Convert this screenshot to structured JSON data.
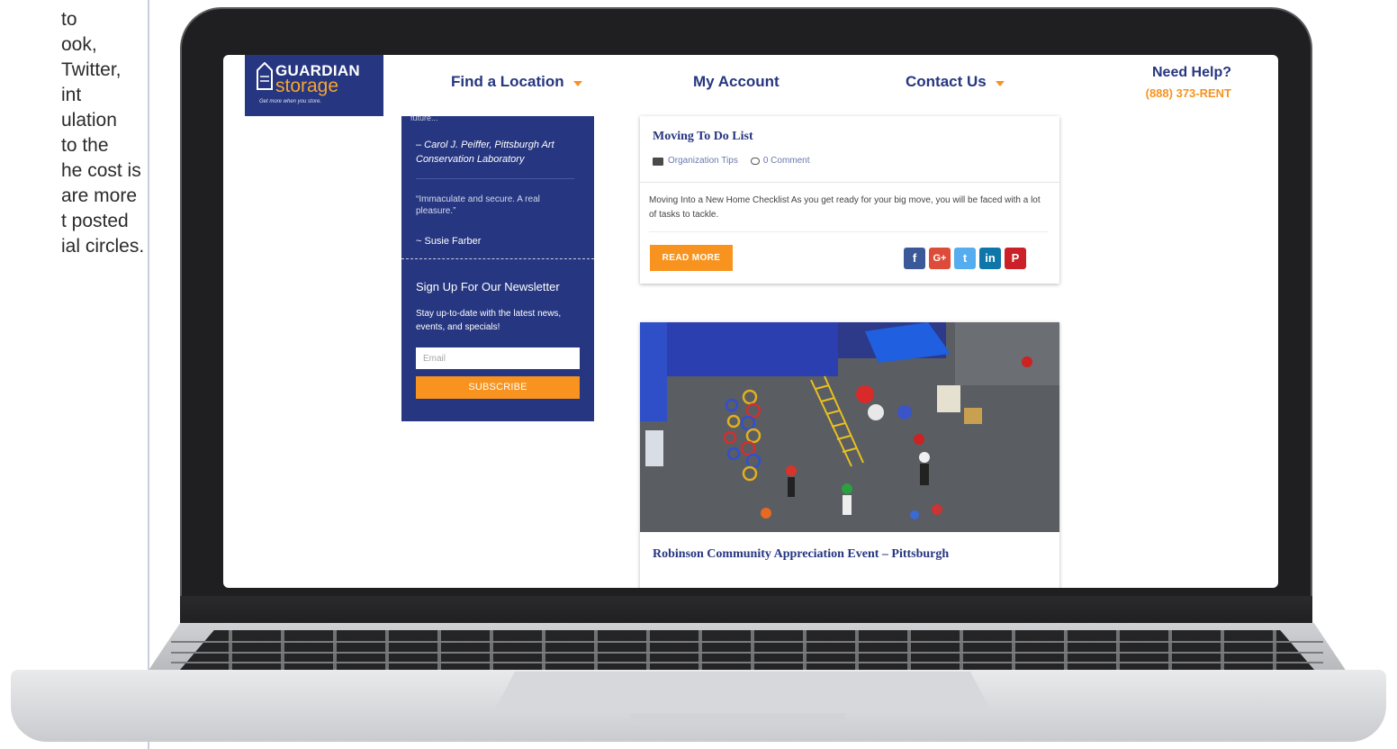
{
  "slide_text": {
    "lines": [
      "to",
      "ook,",
      "Twitter,",
      "int",
      "ulation",
      "to the",
      "he cost is",
      "are more",
      "t posted",
      "ial circles."
    ]
  },
  "header": {
    "logo": {
      "brand_top": "GUARDIAN",
      "brand_bottom": "storage",
      "tagline": "Get more when you store."
    },
    "nav": [
      {
        "label": "Find a Location",
        "has_dropdown": true
      },
      {
        "label": "My Account",
        "has_dropdown": false
      },
      {
        "label": "Contact Us",
        "has_dropdown": true
      }
    ],
    "help": {
      "title": "Need Help?",
      "phone": "(888) 373-RENT"
    }
  },
  "sidebar": {
    "cut_text": "future...",
    "testimonial_author_1": "– Carol J. Peiffer, Pittsburgh Art Conservation Laboratory",
    "testimonial_quote_2": "“Immaculate and secure. A real pleasure.”",
    "testimonial_author_2": "~ Susie Farber",
    "newsletter": {
      "title": "Sign Up For Our Newsletter",
      "text": "Stay up-to-date with the latest news, events, and specials!",
      "email_placeholder": "Email",
      "button": "SUBSCRIBE"
    }
  },
  "posts": [
    {
      "title": "Moving To Do List",
      "category": "Organization Tips",
      "comments": "0 Comment",
      "excerpt": "Moving Into a New Home Checklist As you get ready for your big move, you will be faced with a lot of tasks to tackle.",
      "read_more": "READ MORE",
      "share": [
        {
          "icon": "facebook-icon",
          "glyph": "f",
          "color": "#3b5998"
        },
        {
          "icon": "google-plus-icon",
          "glyph": "G+",
          "color": "#dd4b39"
        },
        {
          "icon": "twitter-icon",
          "glyph": "t",
          "color": "#55acee"
        },
        {
          "icon": "linkedin-icon",
          "glyph": "in",
          "color": "#0e76a8"
        },
        {
          "icon": "pinterest-icon",
          "glyph": "P",
          "color": "#cb2027"
        }
      ]
    },
    {
      "title": "Robinson Community Appreciation Event – Pittsburgh"
    }
  ],
  "colors": {
    "brand_blue": "#263680",
    "accent_orange": "#f7931e"
  }
}
